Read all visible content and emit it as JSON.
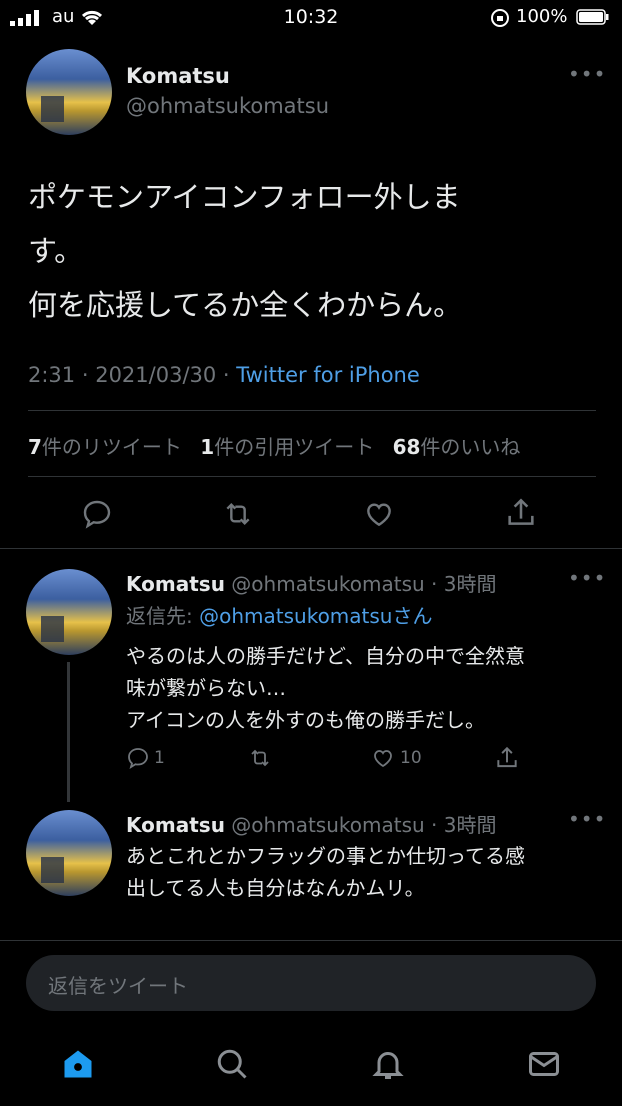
{
  "status_bar": {
    "carrier": "au",
    "time": "10:32",
    "battery": "100%"
  },
  "main_tweet": {
    "display_name": "Komatsu",
    "handle": "@ohmatsukomatsu",
    "text_line1": "ポケモンアイコンフォロー外しま",
    "text_line2": "す。",
    "text_line3": "何を応援してるか全くわからん。",
    "time": "2:31",
    "date": "2021/03/30",
    "source": "Twitter for iPhone",
    "retweet_count": "7",
    "retweet_label": "件のリツイート",
    "quote_count": "1",
    "quote_label": "件の引用ツイート",
    "like_count": "68",
    "like_label": "件のいいね"
  },
  "replies": [
    {
      "display_name": "Komatsu",
      "handle": "@ohmatsukomatsu",
      "time_ago": "3時間",
      "reply_to_prefix": "返信先: ",
      "reply_to_handle": "@ohmatsukomatsu",
      "reply_to_suffix": "さん",
      "line1": "やるのは人の勝手だけど、自分の中で全然意",
      "line2": "味が繋がらない…",
      "line3": "アイコンの人を外すのも俺の勝手だし。",
      "reply_count": "1",
      "like_count": "10"
    },
    {
      "display_name": "Komatsu",
      "handle": "@ohmatsukomatsu",
      "time_ago": "3時間",
      "line1": "あとこれとかフラッグの事とか仕切ってる感",
      "line2": "出してる人も自分はなんかムリ。"
    }
  ],
  "compose": {
    "placeholder": "返信をツイート"
  },
  "tab_bar": [
    "home-icon",
    "search-icon",
    "bell-icon",
    "mail-icon"
  ],
  "colors": {
    "background": "#000000",
    "accent": "#1d9bf0",
    "secondary_text": "#71767b"
  }
}
